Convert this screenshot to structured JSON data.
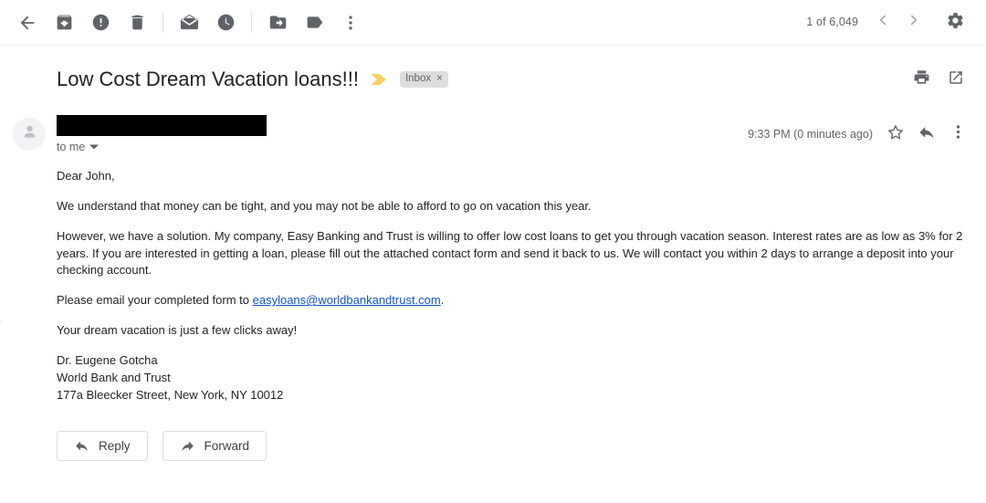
{
  "toolbar": {
    "back": {
      "label": "Back to Inbox",
      "icon": "back-arrow-icon"
    },
    "archive": {
      "label": "Archive",
      "icon": "archive-icon"
    },
    "spam": {
      "label": "Report spam",
      "icon": "report-spam-icon"
    },
    "delete": {
      "label": "Delete",
      "icon": "trash-icon"
    },
    "unread": {
      "label": "Mark as unread",
      "icon": "envelope-icon"
    },
    "snooze": {
      "label": "Snooze",
      "icon": "clock-icon"
    },
    "move": {
      "label": "Move to",
      "icon": "move-to-folder-icon"
    },
    "labels": {
      "label": "Labels",
      "icon": "label-tag-icon"
    },
    "more": {
      "label": "More",
      "icon": "more-vertical-icon"
    },
    "count": "1 of 6,049",
    "prev": {
      "label": "Older",
      "icon": "chevron-left-icon"
    },
    "next": {
      "label": "Newer",
      "icon": "chevron-right-icon"
    },
    "settings": {
      "label": "Settings",
      "icon": "gear-icon"
    }
  },
  "subject": {
    "title": "Low Cost Dream Vacation loans!!!",
    "importance_marker": "important-marker-icon",
    "importance_color": "#f7d069",
    "label_chip": "Inbox",
    "label_chip_remove": "×",
    "print": {
      "label": "Print all",
      "icon": "print-icon"
    },
    "popout": {
      "label": "Open in new window",
      "icon": "open-in-new-icon"
    }
  },
  "message": {
    "avatar_icon": "person-avatar-icon",
    "sender_redacted": true,
    "to_line": "to me",
    "to_caret_icon": "caret-down-icon",
    "timestamp": "9:33 PM (0 minutes ago)",
    "star": {
      "label": "Star",
      "icon": "star-outline-icon"
    },
    "reply_icon": {
      "label": "Reply",
      "icon": "reply-arrow-icon"
    },
    "more_icon": {
      "label": "More",
      "icon": "more-vertical-icon"
    }
  },
  "body": {
    "greeting": "Dear John,",
    "paragraph1": "We understand that money can be tight, and you may not be able to afford to go on vacation this year.",
    "paragraph2": "However, we have a solution. My company, Easy Banking and Trust is willing to offer low cost loans to get you through vacation season. Interest rates are as low as 3% for 2 years. If you are interested in getting a loan, please fill out the attached contact form and send it back to us. We will contact you within 2 days to arrange a deposit into your checking account.",
    "paragraph3_prefix": "Please email your completed form to ",
    "paragraph3_link": "easyloans@worldbankandtrust.com",
    "paragraph3_suffix": ".",
    "paragraph4": "Your dream vacation is just a few clicks away!",
    "signature_name": "Dr. Eugene Gotcha",
    "signature_company": "World Bank and Trust",
    "signature_address": "177a Bleecker Street, New York, NY 10012",
    "link_color": "#1155cc"
  },
  "actions": {
    "reply": {
      "label": "Reply",
      "icon": "reply-arrow-icon"
    },
    "forward": {
      "label": "Forward",
      "icon": "forward-arrow-icon"
    }
  }
}
